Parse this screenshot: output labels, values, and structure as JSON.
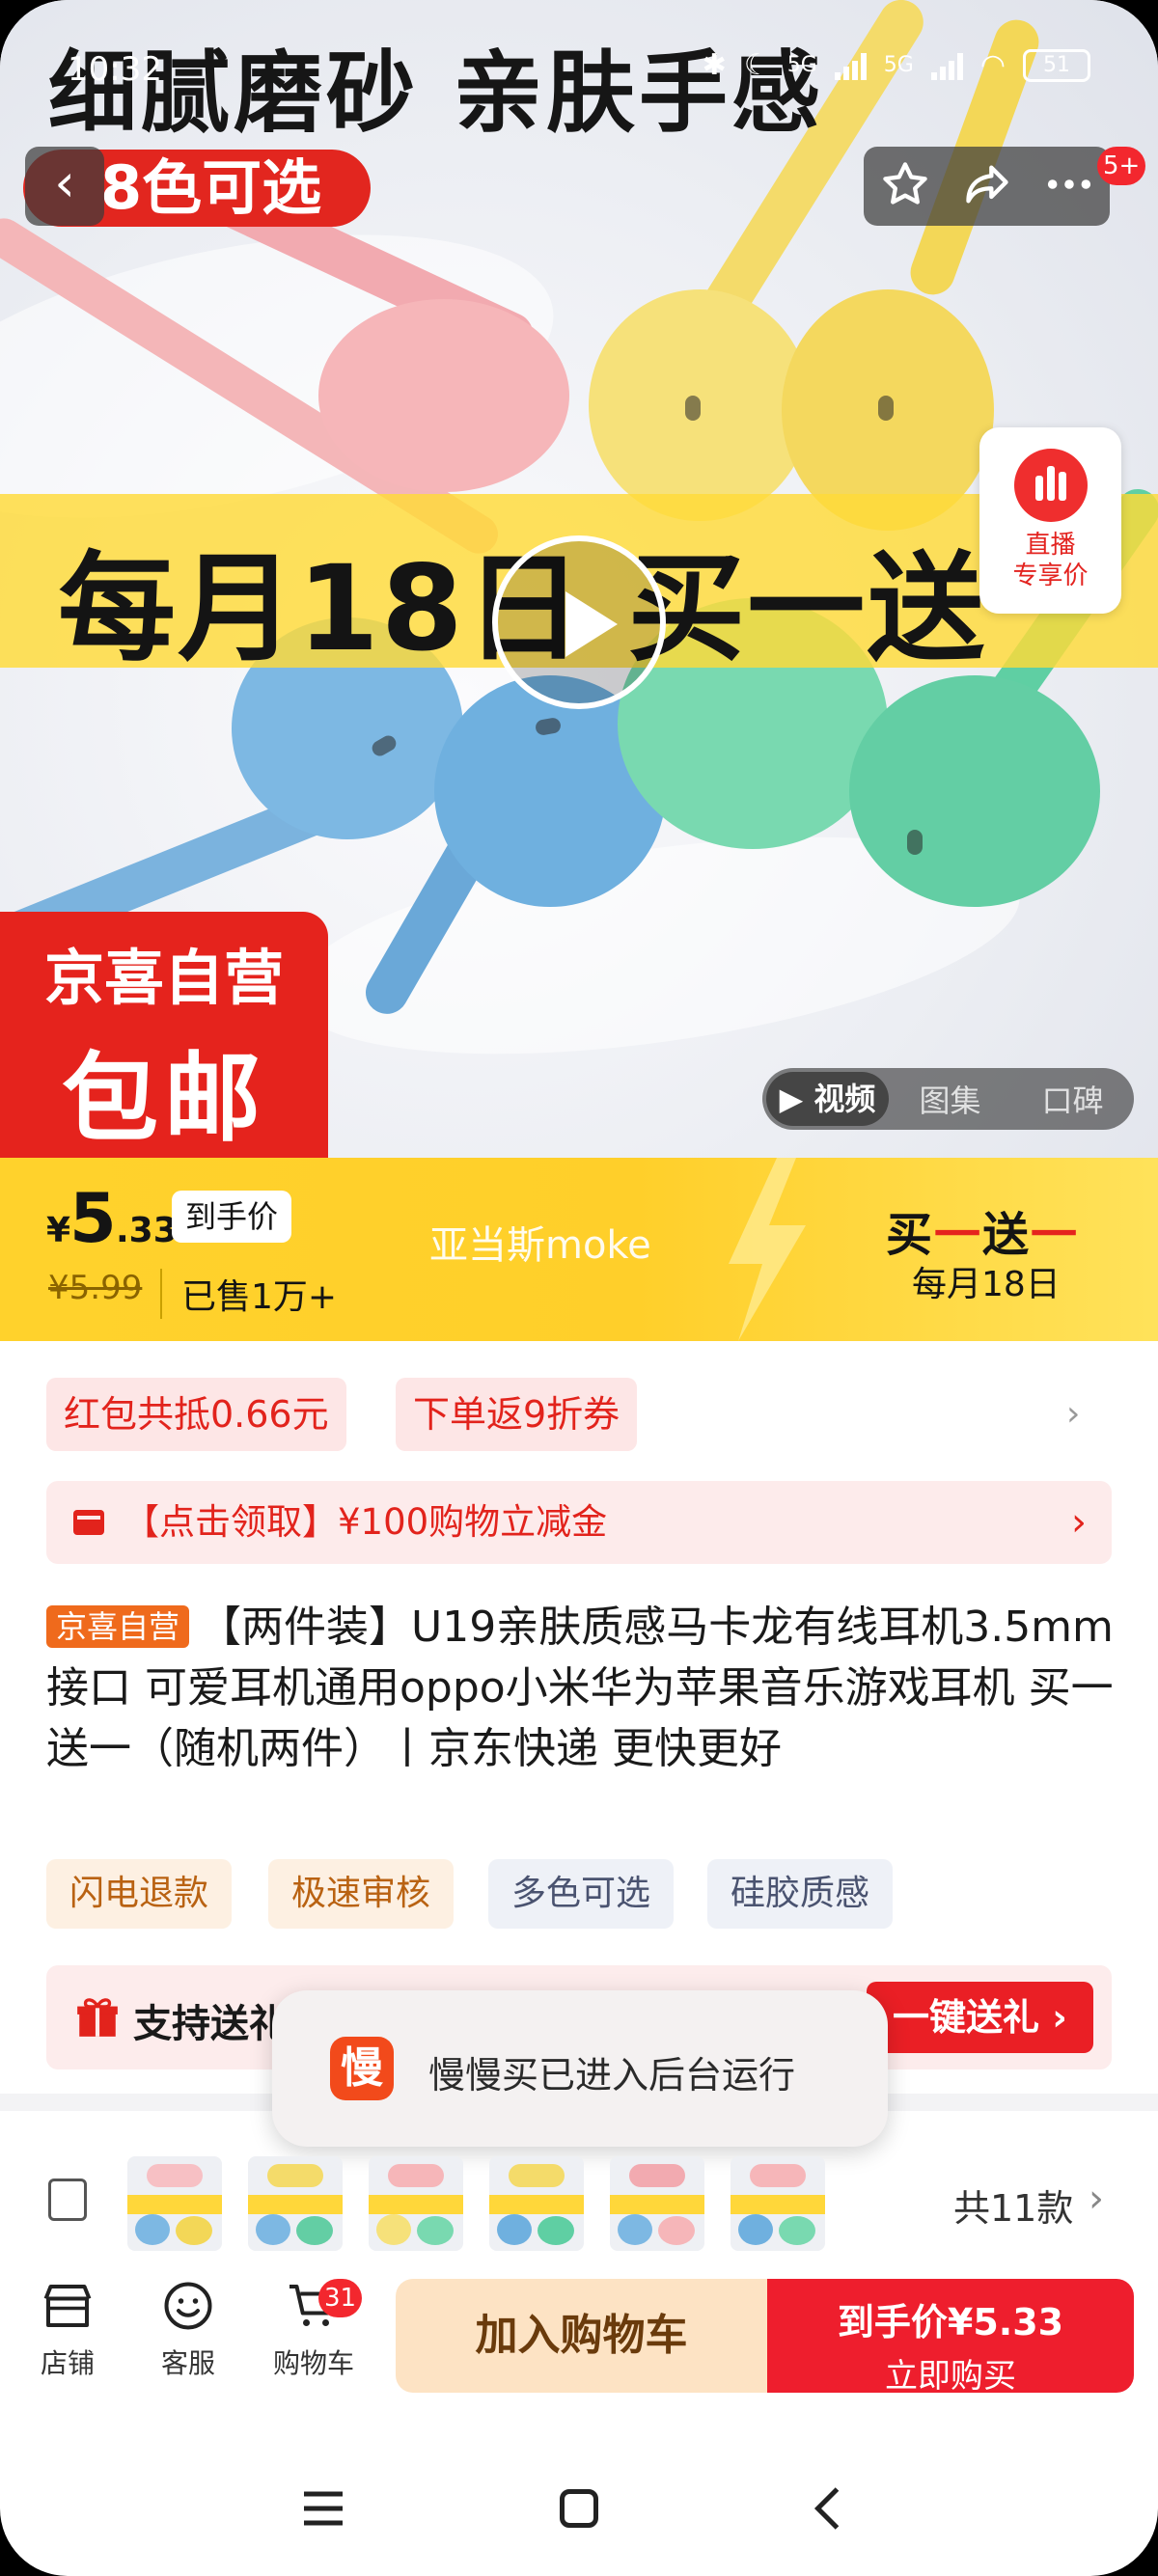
{
  "status_bar": {
    "time": "10:32",
    "network1": "5G",
    "network2": "5G",
    "battery": "51"
  },
  "hero": {
    "top_text": "细腻磨砂 亲肤手感",
    "color_banner": "8色可选",
    "promo_text": "每月18日 买一送",
    "badge_line1": "京喜自营",
    "badge_line2": "包邮",
    "live_badge": {
      "line1": "直播",
      "line2": "专享价"
    },
    "media_tabs": [
      "视频",
      "图集",
      "口碑"
    ],
    "notification_count": "5+"
  },
  "price": {
    "currency": "¥",
    "integer": "5",
    "decimal": ".33",
    "tag": "到手价",
    "original": "¥5.99",
    "sold": "已售1万+",
    "shop_name": "亚当斯moke",
    "bogo_a": "买",
    "bogo_b": "一",
    "bogo_c": "送",
    "bogo_d": "一",
    "bogo_date": "每月18日"
  },
  "coupons": [
    "红包共抵0.66元",
    "下单返9折券"
  ],
  "voucher": {
    "text": "【点击领取】¥100购物立减金"
  },
  "product": {
    "tag": "京喜自营",
    "title": "【两件装】U19亲肤质感马卡龙有线耳机3.5mm接口 可爱耳机通用oppo小米华为苹果音乐游戏耳机 买一送一（随机两件）丨京东快递 更快更好"
  },
  "features": [
    "闪电退款",
    "极速审核",
    "多色可选",
    "硅胶质感"
  ],
  "gift": {
    "text": "支持送礼",
    "button": "一键送礼 ›"
  },
  "toast": {
    "icon_text": "慢",
    "text": "慢慢买已进入后台运行"
  },
  "sku": {
    "count": "共11款"
  },
  "bottom_bar": {
    "store": "店铺",
    "service": "客服",
    "cart": "购物车",
    "cart_count": "31",
    "add_to_cart": "加入购物车",
    "buy_price": "到手价¥5.33",
    "buy_now": "立即购买"
  },
  "colors": {
    "accent_red": "#ee1e2d",
    "promo_yellow": "#ffd22c",
    "brand_orange": "#ef6a1c"
  }
}
